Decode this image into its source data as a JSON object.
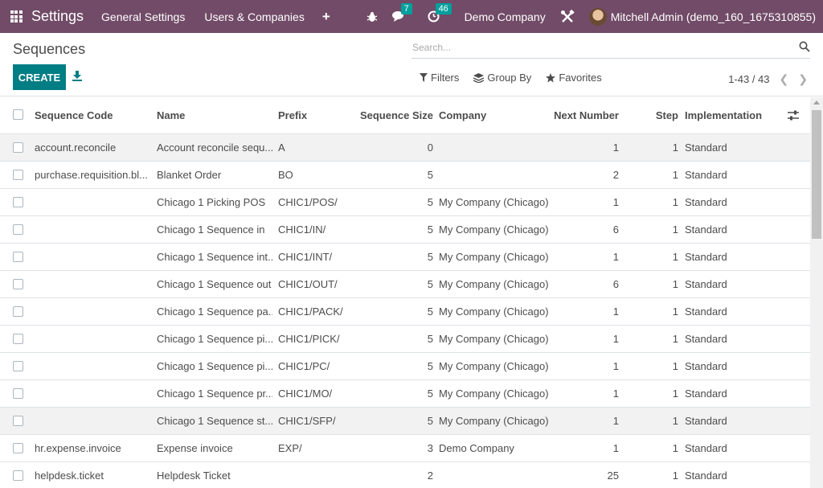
{
  "navbar": {
    "app_name": "Settings",
    "menu": [
      "General Settings",
      "Users & Companies"
    ],
    "plus": "+",
    "messages_count": "7",
    "activities_count": "46",
    "company": "Demo Company",
    "user": "Mitchell Admin (demo_160_1675310855)",
    "bg_color": "#714B67"
  },
  "control_panel": {
    "title": "Sequences",
    "create_label": "CREATE",
    "search_placeholder": "Search...",
    "filters_label": "Filters",
    "groupby_label": "Group By",
    "favorites_label": "Favorites",
    "pager_value": "1-43 / 43",
    "accent_color": "#017E84"
  },
  "table": {
    "columns": [
      "Sequence Code",
      "Name",
      "Prefix",
      "Sequence Size",
      "Company",
      "Next Number",
      "Step",
      "Implementation"
    ],
    "rows": [
      {
        "code": "account.reconcile",
        "name": "Account reconcile sequ...",
        "prefix": "A",
        "size": "0",
        "company": "",
        "next": "1",
        "step": "1",
        "impl": "Standard"
      },
      {
        "code": "purchase.requisition.bl...",
        "name": "Blanket Order",
        "prefix": "BO",
        "size": "5",
        "company": "",
        "next": "2",
        "step": "1",
        "impl": "Standard"
      },
      {
        "code": "",
        "name": "Chicago 1 Picking POS",
        "prefix": "CHIC1/POS/",
        "size": "5",
        "company": "My Company (Chicago)",
        "next": "1",
        "step": "1",
        "impl": "Standard"
      },
      {
        "code": "",
        "name": "Chicago 1 Sequence in",
        "prefix": "CHIC1/IN/",
        "size": "5",
        "company": "My Company (Chicago)",
        "next": "6",
        "step": "1",
        "impl": "Standard"
      },
      {
        "code": "",
        "name": "Chicago 1 Sequence int...",
        "prefix": "CHIC1/INT/",
        "size": "5",
        "company": "My Company (Chicago)",
        "next": "1",
        "step": "1",
        "impl": "Standard"
      },
      {
        "code": "",
        "name": "Chicago 1 Sequence out",
        "prefix": "CHIC1/OUT/",
        "size": "5",
        "company": "My Company (Chicago)",
        "next": "6",
        "step": "1",
        "impl": "Standard"
      },
      {
        "code": "",
        "name": "Chicago 1 Sequence pa...",
        "prefix": "CHIC1/PACK/",
        "size": "5",
        "company": "My Company (Chicago)",
        "next": "1",
        "step": "1",
        "impl": "Standard"
      },
      {
        "code": "",
        "name": "Chicago 1 Sequence pi...",
        "prefix": "CHIC1/PICK/",
        "size": "5",
        "company": "My Company (Chicago)",
        "next": "1",
        "step": "1",
        "impl": "Standard"
      },
      {
        "code": "",
        "name": "Chicago 1 Sequence pi...",
        "prefix": "CHIC1/PC/",
        "size": "5",
        "company": "My Company (Chicago)",
        "next": "1",
        "step": "1",
        "impl": "Standard"
      },
      {
        "code": "",
        "name": "Chicago 1 Sequence pr...",
        "prefix": "CHIC1/MO/",
        "size": "5",
        "company": "My Company (Chicago)",
        "next": "1",
        "step": "1",
        "impl": "Standard"
      },
      {
        "code": "",
        "name": "Chicago 1 Sequence st...",
        "prefix": "CHIC1/SFP/",
        "size": "5",
        "company": "My Company (Chicago)",
        "next": "1",
        "step": "1",
        "impl": "Standard"
      },
      {
        "code": "hr.expense.invoice",
        "name": "Expense invoice",
        "prefix": "EXP/",
        "size": "3",
        "company": "Demo Company",
        "next": "1",
        "step": "1",
        "impl": "Standard"
      },
      {
        "code": "helpdesk.ticket",
        "name": "Helpdesk Ticket",
        "prefix": "",
        "size": "2",
        "company": "",
        "next": "25",
        "step": "1",
        "impl": "Standard"
      }
    ]
  }
}
